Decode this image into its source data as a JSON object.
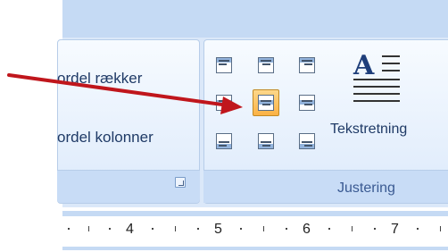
{
  "ribbon": {
    "layout_group": {
      "distribute_rows_label": "ordel rækker",
      "distribute_cols_label": "ordel kolonner"
    },
    "alignment_group": {
      "title": "Justering",
      "text_direction_label": "Tekstretning",
      "text_direction_glyph": "A",
      "buttons": [
        {
          "name": "align-top-left",
          "selected": false
        },
        {
          "name": "align-top-center",
          "selected": false
        },
        {
          "name": "align-top-right",
          "selected": false
        },
        {
          "name": "align-center-left",
          "selected": false
        },
        {
          "name": "align-center",
          "selected": true
        },
        {
          "name": "align-center-right",
          "selected": false
        },
        {
          "name": "align-bottom-left",
          "selected": false
        },
        {
          "name": "align-bottom-center",
          "selected": false
        },
        {
          "name": "align-bottom-right",
          "selected": false
        }
      ]
    }
  },
  "ruler": {
    "numbers": [
      "4",
      "5",
      "6",
      "7"
    ]
  },
  "colors": {
    "arrow": "#c0161c",
    "selected_button": "#fbb244"
  }
}
